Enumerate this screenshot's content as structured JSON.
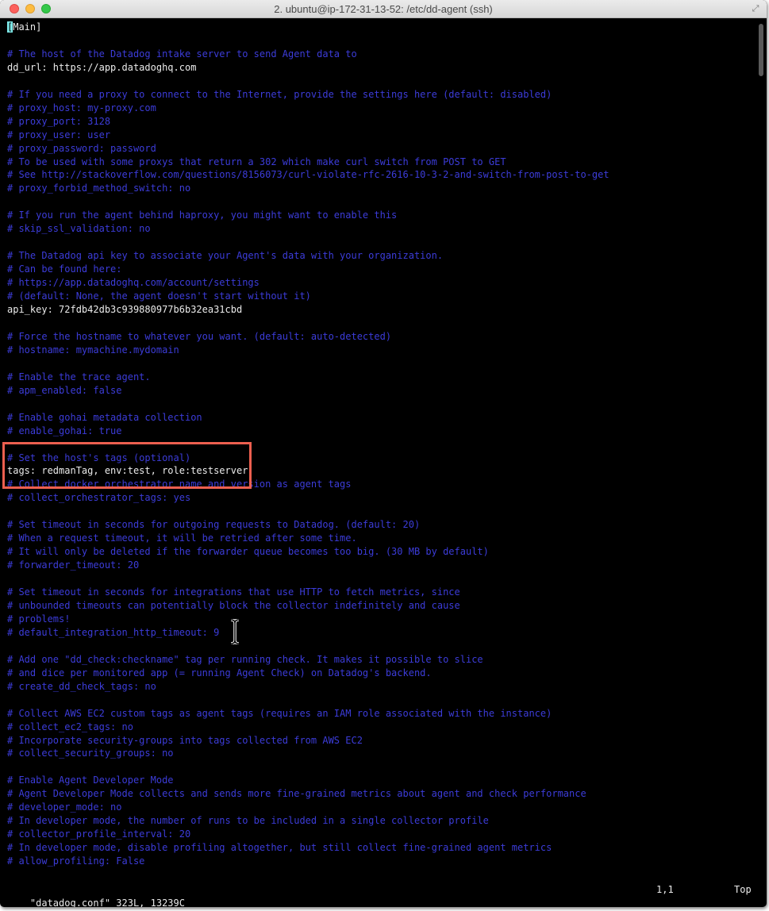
{
  "window": {
    "title": "2. ubuntu@ip-172-31-13-52: /etc/dd-agent (ssh)"
  },
  "colors": {
    "comment": "#3c3cd9",
    "text": "#ebebeb",
    "background": "#000000",
    "cursor": "#7de8e8",
    "highlight_box": "#ec5f4f"
  },
  "icons": {
    "close": "close-traffic-light-icon",
    "minimize": "minimize-traffic-light-icon",
    "maximize": "maximize-traffic-light-icon",
    "fullscreen": "resize-arrows-icon",
    "mouse_cursor": "ibeam-cursor-icon"
  },
  "editor": {
    "cursor_char": "[",
    "lines": [
      {
        "text": "Main]",
        "type": "section"
      },
      {
        "text": "",
        "type": "blank"
      },
      {
        "text": "# The host of the Datadog intake server to send Agent data to",
        "type": "comment"
      },
      {
        "text": "dd_url: https://app.datadoghq.com",
        "type": "setting"
      },
      {
        "text": "",
        "type": "blank"
      },
      {
        "text": "# If you need a proxy to connect to the Internet, provide the settings here (default: disabled)",
        "type": "comment"
      },
      {
        "text": "# proxy_host: my-proxy.com",
        "type": "comment"
      },
      {
        "text": "# proxy_port: 3128",
        "type": "comment"
      },
      {
        "text": "# proxy_user: user",
        "type": "comment"
      },
      {
        "text": "# proxy_password: password",
        "type": "comment"
      },
      {
        "text": "# To be used with some proxys that return a 302 which make curl switch from POST to GET",
        "type": "comment"
      },
      {
        "text": "# See http://stackoverflow.com/questions/8156073/curl-violate-rfc-2616-10-3-2-and-switch-from-post-to-get",
        "type": "comment"
      },
      {
        "text": "# proxy_forbid_method_switch: no",
        "type": "comment"
      },
      {
        "text": "",
        "type": "blank"
      },
      {
        "text": "# If you run the agent behind haproxy, you might want to enable this",
        "type": "comment"
      },
      {
        "text": "# skip_ssl_validation: no",
        "type": "comment"
      },
      {
        "text": "",
        "type": "blank"
      },
      {
        "text": "# The Datadog api key to associate your Agent's data with your organization.",
        "type": "comment"
      },
      {
        "text": "# Can be found here:",
        "type": "comment"
      },
      {
        "text": "# https://app.datadoghq.com/account/settings",
        "type": "comment"
      },
      {
        "text": "# (default: None, the agent doesn't start without it)",
        "type": "comment"
      },
      {
        "text": "api_key: 72fdb42db3c939880977b6b32ea31cbd",
        "type": "setting"
      },
      {
        "text": "",
        "type": "blank"
      },
      {
        "text": "# Force the hostname to whatever you want. (default: auto-detected)",
        "type": "comment"
      },
      {
        "text": "# hostname: mymachine.mydomain",
        "type": "comment"
      },
      {
        "text": "",
        "type": "blank"
      },
      {
        "text": "# Enable the trace agent.",
        "type": "comment"
      },
      {
        "text": "# apm_enabled: false",
        "type": "comment"
      },
      {
        "text": "",
        "type": "blank"
      },
      {
        "text": "# Enable gohai metadata collection",
        "type": "comment"
      },
      {
        "text": "# enable_gohai: true",
        "type": "comment"
      },
      {
        "text": "",
        "type": "blank"
      },
      {
        "text": "# Set the host's tags (optional)",
        "type": "comment"
      },
      {
        "text": "tags: redmanTag, env:test, role:testserver",
        "type": "setting"
      },
      {
        "text": "# Collect docker orchestrator name and version as agent tags",
        "type": "comment"
      },
      {
        "text": "# collect_orchestrator_tags: yes",
        "type": "comment"
      },
      {
        "text": "",
        "type": "blank"
      },
      {
        "text": "# Set timeout in seconds for outgoing requests to Datadog. (default: 20)",
        "type": "comment"
      },
      {
        "text": "# When a request timeout, it will be retried after some time.",
        "type": "comment"
      },
      {
        "text": "# It will only be deleted if the forwarder queue becomes too big. (30 MB by default)",
        "type": "comment"
      },
      {
        "text": "# forwarder_timeout: 20",
        "type": "comment"
      },
      {
        "text": "",
        "type": "blank"
      },
      {
        "text": "# Set timeout in seconds for integrations that use HTTP to fetch metrics, since",
        "type": "comment"
      },
      {
        "text": "# unbounded timeouts can potentially block the collector indefinitely and cause",
        "type": "comment"
      },
      {
        "text": "# problems!",
        "type": "comment"
      },
      {
        "text": "# default_integration_http_timeout: 9",
        "type": "comment"
      },
      {
        "text": "",
        "type": "blank"
      },
      {
        "text": "# Add one \"dd_check:checkname\" tag per running check. It makes it possible to slice",
        "type": "comment"
      },
      {
        "text": "# and dice per monitored app (= running Agent Check) on Datadog's backend.",
        "type": "comment"
      },
      {
        "text": "# create_dd_check_tags: no",
        "type": "comment"
      },
      {
        "text": "",
        "type": "blank"
      },
      {
        "text": "# Collect AWS EC2 custom tags as agent tags (requires an IAM role associated with the instance)",
        "type": "comment"
      },
      {
        "text": "# collect_ec2_tags: no",
        "type": "comment"
      },
      {
        "text": "# Incorporate security-groups into tags collected from AWS EC2",
        "type": "comment"
      },
      {
        "text": "# collect_security_groups: no",
        "type": "comment"
      },
      {
        "text": "",
        "type": "blank"
      },
      {
        "text": "# Enable Agent Developer Mode",
        "type": "comment"
      },
      {
        "text": "# Agent Developer Mode collects and sends more fine-grained metrics about agent and check performance",
        "type": "comment"
      },
      {
        "text": "# developer_mode: no",
        "type": "comment"
      },
      {
        "text": "# In developer mode, the number of runs to be included in a single collector profile",
        "type": "comment"
      },
      {
        "text": "# collector_profile_interval: 20",
        "type": "comment"
      },
      {
        "text": "# In developer mode, disable profiling altogether, but still collect fine-grained agent metrics",
        "type": "comment"
      },
      {
        "text": "# allow_profiling: False",
        "type": "comment"
      }
    ]
  },
  "status_bar": {
    "file_info": "\"datadog.conf\" 323L, 13239C",
    "position": "1,1",
    "scroll": "Top"
  }
}
